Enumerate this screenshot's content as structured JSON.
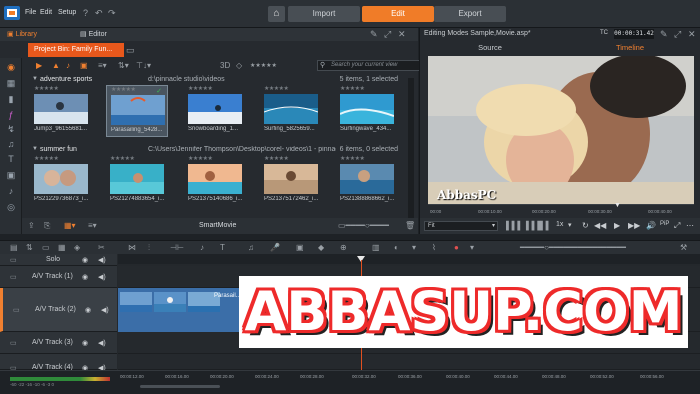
{
  "app": {
    "menu": [
      "File",
      "Edit",
      "Setup"
    ],
    "modes": [
      "Import",
      "Edit",
      "Export"
    ],
    "active_mode": "Edit"
  },
  "library": {
    "tabs": [
      "Library",
      "Editor"
    ],
    "project_tab": "Project Bin: Family Fun...",
    "search_placeholder": "Search your current view",
    "toolbar_3d": "3D",
    "toolbar_stars": "★★★★★",
    "groups": [
      {
        "name": "adventure sports",
        "path": "d:\\pinnacle studio\\videos",
        "count": "5 items, 1 selected",
        "clips": [
          {
            "name": "Jump3_96155681...",
            "stars": "★★★★★"
          },
          {
            "name": "Parasailing_5428...",
            "stars": "★★★★★"
          },
          {
            "name": "Snowboarding_1...",
            "stars": "★★★★★"
          },
          {
            "name": "Surfing_5825659...",
            "stars": "★★★★★"
          },
          {
            "name": "Surfingwave_434...",
            "stars": "★★★★★"
          }
        ]
      },
      {
        "name": "summer fun",
        "path": "C:\\Users\\Jennifer Thompson\\Desktop\\corel- videos\\1 - pinnacle studio...",
        "count": "6 items, 0 selected",
        "clips": [
          {
            "name": "PS21229736873_i...",
            "stars": "★★★★★"
          },
          {
            "name": "PS21274883654_i...",
            "stars": "★★★★★"
          },
          {
            "name": "PS21375140686_i...",
            "stars": "★★★★★"
          },
          {
            "name": "PS21375172462_i...",
            "stars": "★★★★★"
          },
          {
            "name": "PS21388868662_i...",
            "stars": "★★★★★"
          }
        ]
      }
    ],
    "bottom_label": "SmartMovie"
  },
  "player": {
    "title": "Editing Modes Sample,Movie.asp*",
    "tc_label": "TC",
    "timecode": "00:00:31.42",
    "tabs": [
      "Source",
      "Timeline"
    ],
    "active_tab": "Timeline",
    "overlay_text": "AbbasPC",
    "ruler_ticks": [
      "00:00",
      "00:00:10.00",
      "00:00:20.00",
      "00:00:30.00",
      "00:00:40.00"
    ],
    "fit": "Fit",
    "speed": "1x",
    "pip": "PiP"
  },
  "timeline": {
    "solo": "Solo",
    "tracks": [
      "A/V Track (1)",
      "A/V Track (2)",
      "A/V Track (3)",
      "A/V Track (4)"
    ],
    "clip_label": "Parasail...",
    "ruler_ticks": [
      "00:00:12.00",
      "00:00:16.00",
      "00:00:20.00",
      "00:00:24.00",
      "00:00:28.00",
      "00:00:32.00",
      "00:00:36.00",
      "00:00:40.00",
      "00:00:44.00",
      "00:00:48.00",
      "00:00:52.00",
      "00:00:56.00"
    ],
    "meter_scale": "-60  -22  -16  -10  -6  -3  0"
  },
  "banner": {
    "text": "ABBASUP.COM"
  }
}
